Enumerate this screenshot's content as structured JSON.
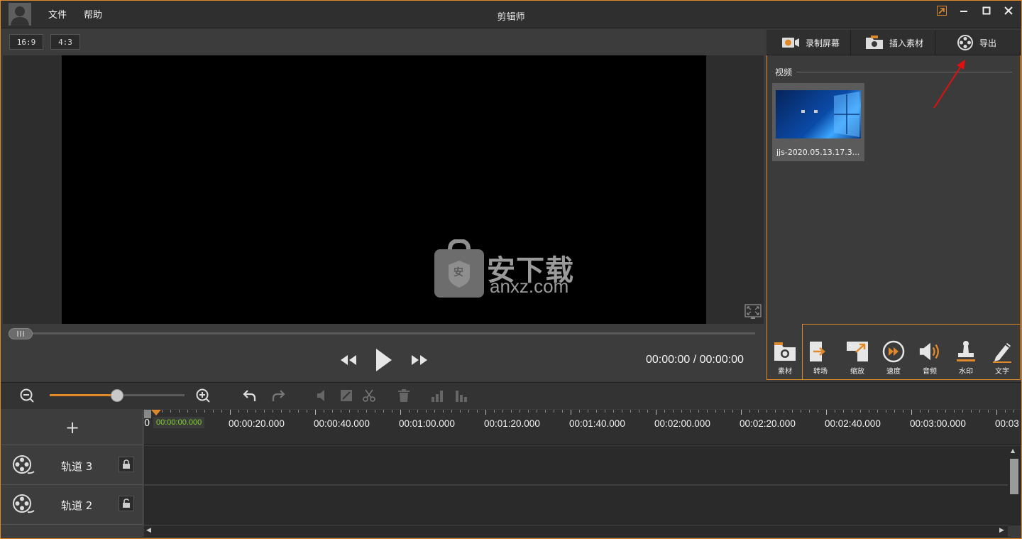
{
  "titlebar": {
    "title": "剪辑师",
    "menu": [
      {
        "label": "文件"
      },
      {
        "label": "帮助"
      }
    ]
  },
  "preview": {
    "ratios": [
      "16:9",
      "4:3"
    ],
    "timecode": "00:00:00 / 00:00:00"
  },
  "watermark": {
    "main": "安下载",
    "sub": "anxz.com",
    "badge": "安"
  },
  "right_panel": {
    "tabs": [
      {
        "label": "录制屏幕",
        "icon": "record-screen-icon"
      },
      {
        "label": "插入素材",
        "icon": "insert-media-icon"
      },
      {
        "label": "导出",
        "icon": "export-film-icon"
      }
    ],
    "section_label": "视频",
    "media": [
      {
        "name": "jjs-2020.05.13.17.3..."
      }
    ],
    "tools": [
      {
        "label": "素材",
        "icon": "media-folder-icon"
      },
      {
        "label": "转场",
        "icon": "transition-icon"
      },
      {
        "label": "缩放",
        "icon": "zoom-icon"
      },
      {
        "label": "速度",
        "icon": "speed-icon"
      },
      {
        "label": "音频",
        "icon": "audio-icon"
      },
      {
        "label": "水印",
        "icon": "watermark-stamp-icon"
      },
      {
        "label": "文字",
        "icon": "text-pen-icon"
      }
    ]
  },
  "timeline": {
    "zoom_level": 0.5,
    "add_track": "+",
    "playhead": "00:00:00.000",
    "playhead_cut": "0",
    "ticks": [
      "00:00:20.000",
      "00:00:40.000",
      "00:01:00.000",
      "00:01:20.000",
      "00:01:40.000",
      "00:02:00.000",
      "00:02:20.000",
      "00:02:40.000",
      "00:03:00.000",
      "00:03"
    ],
    "tracks": [
      {
        "name": "轨道 3",
        "locked": true
      },
      {
        "name": "轨道 2",
        "locked": false
      }
    ]
  },
  "colors": {
    "accent": "#e0892a",
    "playhead_text": "#7fd62c"
  }
}
